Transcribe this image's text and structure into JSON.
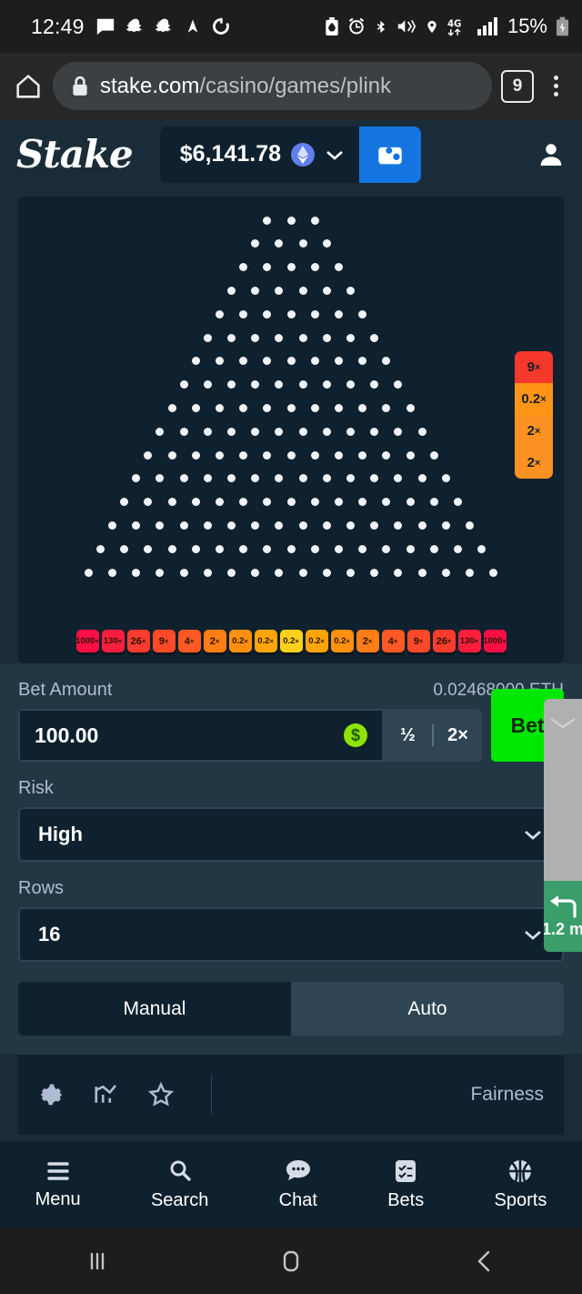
{
  "status_bar": {
    "time": "12:49",
    "battery_percent": "15%",
    "left_icons": [
      "message-icon",
      "snapchat-icon",
      "snapchat-icon",
      "navigation-arrow-icon",
      "sync-icon"
    ],
    "right_icons": [
      "battery-saver-icon",
      "alarm-icon",
      "bluetooth-icon",
      "vibrate-icon",
      "location-icon",
      "4g-icon",
      "signal-bars-icon",
      "charging-battery-icon"
    ]
  },
  "browser": {
    "home_icon": "home-icon",
    "lock_icon": "lock-icon",
    "url_domain": "stake.com",
    "url_path": "/casino/games/plink",
    "tab_count": "9",
    "menu_icon": "kebab-menu-icon"
  },
  "header": {
    "logo": "Stake",
    "balance": "$6,141.78",
    "currency_icon": "ethereum-icon",
    "chevron_icon": "chevron-down-icon",
    "wallet_icon": "wallet-icon",
    "profile_icon": "user-avatar-icon"
  },
  "game": {
    "rows_count": 16,
    "multipliers": [
      {
        "label": "1000",
        "suffix": "×",
        "color": "#ff0f45"
      },
      {
        "label": "130",
        "suffix": "×",
        "color": "#ff1f3d"
      },
      {
        "label": "26",
        "suffix": "×",
        "color": "#ff3b2f"
      },
      {
        "label": "9",
        "suffix": "×",
        "color": "#ff4929"
      },
      {
        "label": "4",
        "suffix": "×",
        "color": "#ff5a25"
      },
      {
        "label": "2",
        "suffix": "×",
        "color": "#ff7d17"
      },
      {
        "label": "0.2",
        "suffix": "×",
        "color": "#ff9010"
      },
      {
        "label": "0.2",
        "suffix": "×",
        "color": "#ffa50a"
      },
      {
        "label": "0.2",
        "suffix": "×",
        "color": "#ffd11a"
      },
      {
        "label": "0.2",
        "suffix": "×",
        "color": "#ffa50a"
      },
      {
        "label": "0.2",
        "suffix": "×",
        "color": "#ff9010"
      },
      {
        "label": "2",
        "suffix": "×",
        "color": "#ff7d17"
      },
      {
        "label": "4",
        "suffix": "×",
        "color": "#ff5a25"
      },
      {
        "label": "9",
        "suffix": "×",
        "color": "#ff4929"
      },
      {
        "label": "26",
        "suffix": "×",
        "color": "#ff3b2f"
      },
      {
        "label": "130",
        "suffix": "×",
        "color": "#ff1f3d"
      },
      {
        "label": "1000",
        "suffix": "×",
        "color": "#ff0f45"
      }
    ],
    "history": [
      {
        "label": "9",
        "suffix": "×",
        "color": "#f5382c"
      },
      {
        "label": "0.2",
        "suffix": "×",
        "color": "#ff9417"
      },
      {
        "label": "2",
        "suffix": "×",
        "color": "#fb9221"
      },
      {
        "label": "2",
        "suffix": "×",
        "color": "#fb9221"
      }
    ]
  },
  "controls": {
    "bet_amount_label": "Bet Amount",
    "bet_amount_secondary": "0.02468000 ETH",
    "bet_amount_value": "100.00",
    "bet_amount_placeholder": "0.00",
    "currency_badge": "$",
    "half_label": "½",
    "double_label": "2×",
    "bet_button": "Bet",
    "risk_label": "Risk",
    "risk_value": "High",
    "rows_label": "Rows",
    "rows_value": "16",
    "tab_manual": "Manual",
    "tab_auto": "Auto",
    "active_tab": "Manual"
  },
  "footer": {
    "settings_icon": "gear-icon",
    "stats_icon": "stats-chart-icon",
    "favourite_icon": "star-icon",
    "fairness_label": "Fairness"
  },
  "bottom_nav": [
    {
      "label": "Menu",
      "icon": "hamburger-icon"
    },
    {
      "label": "Search",
      "icon": "search-icon"
    },
    {
      "label": "Chat",
      "icon": "chat-bubble-icon"
    },
    {
      "label": "Bets",
      "icon": "bets-list-icon"
    },
    {
      "label": "Sports",
      "icon": "basketball-icon"
    }
  ],
  "overlay": {
    "nav_distance": "1.2 m",
    "turn_icon": "turn-left-arrow-icon"
  },
  "android_nav": {
    "recents_icon": "recents-icon",
    "home_icon": "home-square-icon",
    "back_icon": "back-chevron-icon"
  },
  "colors": {
    "page_bg": "#1a2c38",
    "panel_bg": "#0f212e",
    "control_bg": "#213743",
    "accent_green": "#00e701",
    "accent_blue": "#1475e1"
  }
}
